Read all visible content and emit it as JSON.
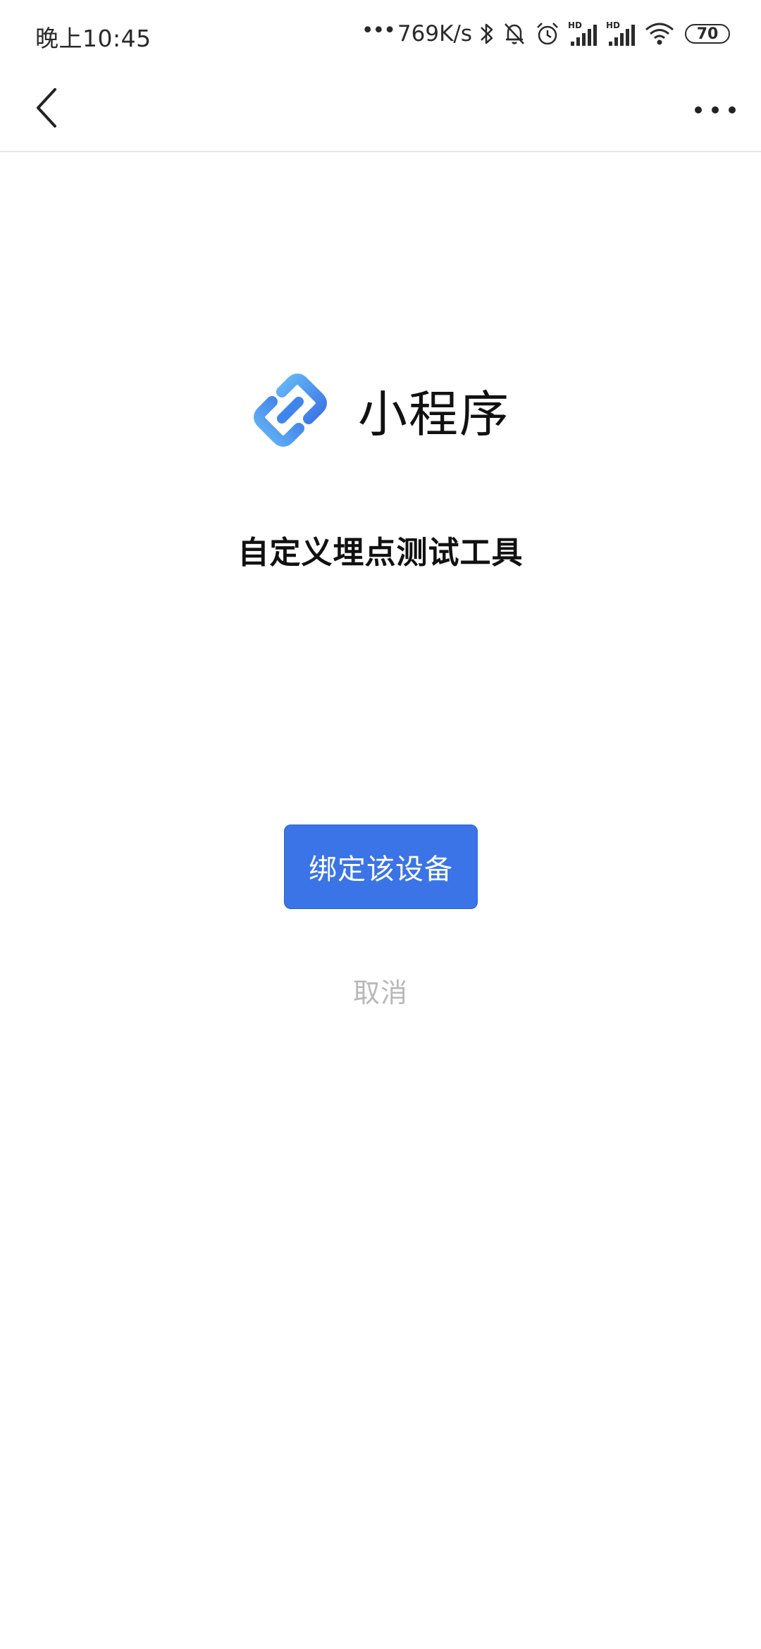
{
  "status_bar": {
    "time": "晚上10:45",
    "network_speed": "769K/s",
    "battery_level": "70",
    "hd_label": "HD",
    "icons": [
      "more-dots-icon",
      "bluetooth-icon",
      "bell-muted-icon",
      "alarm-icon",
      "hd-signal-icon",
      "hd-signal-icon",
      "wifi-icon",
      "battery-icon"
    ]
  },
  "nav_bar": {
    "back_icon": "chevron-left-icon",
    "more_icon": "more-horizontal-icon"
  },
  "brand": {
    "logo_icon": "mini-program-logo-icon",
    "name": "小程序"
  },
  "app": {
    "title": "自定义埋点测试工具"
  },
  "actions": {
    "bind_label": "绑定该设备",
    "cancel_label": "取消"
  },
  "colors": {
    "primary": "#3a74e6",
    "logo_light": "#5fb0f5",
    "logo_dark": "#3a74e6",
    "cancel_text": "#b8b8b8"
  }
}
